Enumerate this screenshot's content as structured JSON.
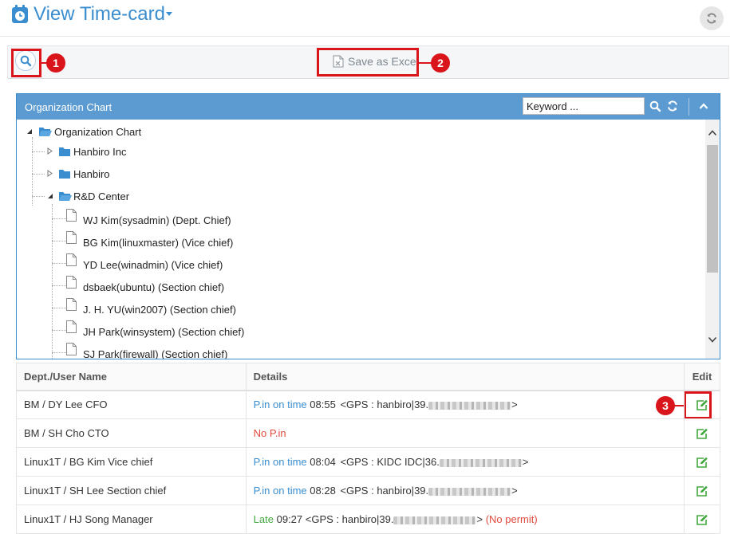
{
  "header": {
    "title": "View Time-card"
  },
  "toolbar": {
    "excel_label": "Save as Excel"
  },
  "callouts": [
    "1",
    "2",
    "3"
  ],
  "org": {
    "title": "Organization Chart",
    "keyword_value": "Keyword ...",
    "tree": {
      "root": "Organization Chart",
      "groups": [
        "Hanbiro Inc",
        "Hanbiro",
        "R&D Center"
      ],
      "members": [
        "WJ Kim(sysadmin) (Dept. Chief)",
        "BG Kim(linuxmaster) (Vice chief)",
        "YD Lee(winadmin) (Vice chief)",
        "dsbaek(ubuntu) (Section chief)",
        "J. H. YU(win2007) (Section chief)",
        "JH Park(winsystem) (Section chief)",
        "SJ Park(firewall) (Section chief)"
      ]
    }
  },
  "table": {
    "headers": [
      "Dept./User Name",
      "Details",
      "Edit"
    ],
    "rows": [
      {
        "name": "BM / DY Lee CFO",
        "status": "P.in on time",
        "time": "08:55",
        "gps": "<GPS : hanbiro|39.",
        "end": ">",
        "note": ""
      },
      {
        "name": "BM / SH Cho CTO",
        "status": "No P.in",
        "time": "",
        "gps": "",
        "end": "",
        "note": ""
      },
      {
        "name": "Linux1T / BG Kim Vice chief",
        "status": "P.in on time",
        "time": "08:04",
        "gps": "<GPS : KIDC IDC|36.",
        "end": ">",
        "note": ""
      },
      {
        "name": "Linux1T / SH Lee Section chief",
        "status": "P.in on time",
        "time": "08:28",
        "gps": "<GPS : hanbiro|39.",
        "end": ">",
        "note": ""
      },
      {
        "name": "Linux1T / HJ Song Manager",
        "status": "Late",
        "time": "09:27",
        "gps": "<GPS : hanbiro|39.",
        "end": ">",
        "note": "(No permit)"
      }
    ]
  },
  "colors": {
    "accent": "#3a8ed0",
    "panel_header": "#5b9bd1",
    "callout": "#d9141b",
    "status_blue": "#3a8ed0",
    "status_red": "#e14a3c",
    "status_green": "#42a83f"
  },
  "icons": [
    "clock-icon",
    "caret-down-icon",
    "refresh-icon",
    "search-icon",
    "excel-file-icon",
    "folder-icon",
    "document-icon",
    "chevron-up-icon",
    "edit-icon"
  ]
}
